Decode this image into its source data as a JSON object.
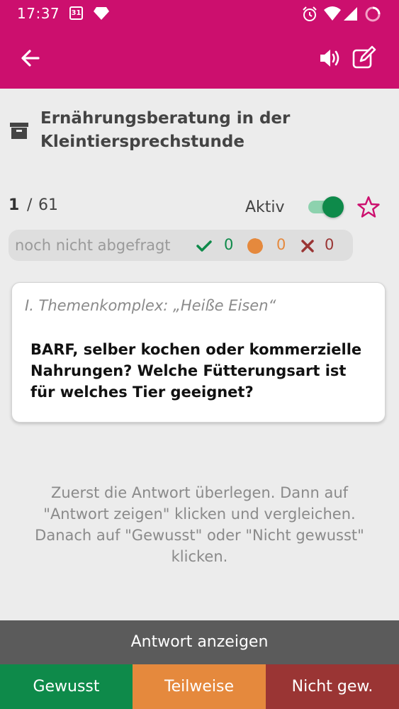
{
  "status_bar": {
    "time": "17:37",
    "calendar_day": "31",
    "icons": [
      "calendar-icon",
      "diamond-icon",
      "alarm-icon",
      "wifi-icon",
      "signal-icon",
      "battery-icon"
    ]
  },
  "app_bar": {
    "icons": [
      "back-arrow-icon",
      "speaker-icon",
      "edit-icon"
    ],
    "color": "#cc0f6e"
  },
  "deck": {
    "icon": "archive-icon",
    "title": "Ernährungsberatung in der Kleintiersprechstunde"
  },
  "counter": {
    "current": "1",
    "separator": "/",
    "total": "61"
  },
  "active_toggle": {
    "label": "Aktiv",
    "on": true
  },
  "favorite_icon": "star-outline-icon",
  "stats": {
    "label": "noch nicht abgefragt",
    "known_count": "0",
    "partial_count": "0",
    "unknown_count": "0",
    "colors": {
      "known": "#0e8a4a",
      "partial": "#e5893d",
      "unknown": "#9a3534"
    }
  },
  "card": {
    "topic": "I. Themenkomplex: „Heiße Eisen“",
    "question": "BARF, selber kochen oder kommerzielle Nahrungen? Welche Fütterungsart ist für welches Tier geeignet?"
  },
  "hint": "Zuerst die Antwort überlegen. Dann auf \"Antwort zeigen\" klicken und vergleichen. Danach auf \"Gewusst\" oder \"Nicht gewusst\" klicken.",
  "buttons": {
    "show_answer": "Antwort anzeigen",
    "known": "Gewusst",
    "partial": "Teilweise",
    "unknown": "Nicht gew."
  }
}
